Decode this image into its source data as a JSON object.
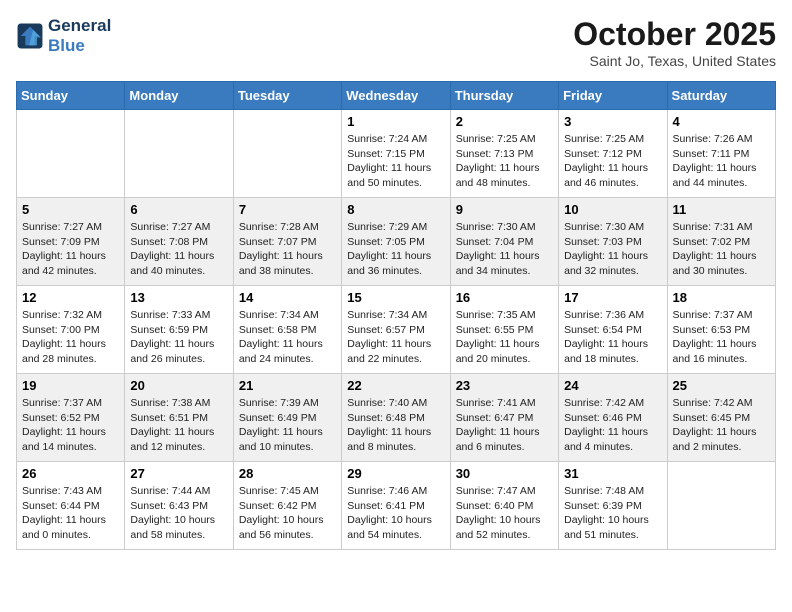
{
  "header": {
    "logo_line1": "General",
    "logo_line2": "Blue",
    "month": "October 2025",
    "location": "Saint Jo, Texas, United States"
  },
  "days_of_week": [
    "Sunday",
    "Monday",
    "Tuesday",
    "Wednesday",
    "Thursday",
    "Friday",
    "Saturday"
  ],
  "weeks": [
    [
      {
        "day": "",
        "info": ""
      },
      {
        "day": "",
        "info": ""
      },
      {
        "day": "",
        "info": ""
      },
      {
        "day": "1",
        "info": "Sunrise: 7:24 AM\nSunset: 7:15 PM\nDaylight: 11 hours and 50 minutes."
      },
      {
        "day": "2",
        "info": "Sunrise: 7:25 AM\nSunset: 7:13 PM\nDaylight: 11 hours and 48 minutes."
      },
      {
        "day": "3",
        "info": "Sunrise: 7:25 AM\nSunset: 7:12 PM\nDaylight: 11 hours and 46 minutes."
      },
      {
        "day": "4",
        "info": "Sunrise: 7:26 AM\nSunset: 7:11 PM\nDaylight: 11 hours and 44 minutes."
      }
    ],
    [
      {
        "day": "5",
        "info": "Sunrise: 7:27 AM\nSunset: 7:09 PM\nDaylight: 11 hours and 42 minutes."
      },
      {
        "day": "6",
        "info": "Sunrise: 7:27 AM\nSunset: 7:08 PM\nDaylight: 11 hours and 40 minutes."
      },
      {
        "day": "7",
        "info": "Sunrise: 7:28 AM\nSunset: 7:07 PM\nDaylight: 11 hours and 38 minutes."
      },
      {
        "day": "8",
        "info": "Sunrise: 7:29 AM\nSunset: 7:05 PM\nDaylight: 11 hours and 36 minutes."
      },
      {
        "day": "9",
        "info": "Sunrise: 7:30 AM\nSunset: 7:04 PM\nDaylight: 11 hours and 34 minutes."
      },
      {
        "day": "10",
        "info": "Sunrise: 7:30 AM\nSunset: 7:03 PM\nDaylight: 11 hours and 32 minutes."
      },
      {
        "day": "11",
        "info": "Sunrise: 7:31 AM\nSunset: 7:02 PM\nDaylight: 11 hours and 30 minutes."
      }
    ],
    [
      {
        "day": "12",
        "info": "Sunrise: 7:32 AM\nSunset: 7:00 PM\nDaylight: 11 hours and 28 minutes."
      },
      {
        "day": "13",
        "info": "Sunrise: 7:33 AM\nSunset: 6:59 PM\nDaylight: 11 hours and 26 minutes."
      },
      {
        "day": "14",
        "info": "Sunrise: 7:34 AM\nSunset: 6:58 PM\nDaylight: 11 hours and 24 minutes."
      },
      {
        "day": "15",
        "info": "Sunrise: 7:34 AM\nSunset: 6:57 PM\nDaylight: 11 hours and 22 minutes."
      },
      {
        "day": "16",
        "info": "Sunrise: 7:35 AM\nSunset: 6:55 PM\nDaylight: 11 hours and 20 minutes."
      },
      {
        "day": "17",
        "info": "Sunrise: 7:36 AM\nSunset: 6:54 PM\nDaylight: 11 hours and 18 minutes."
      },
      {
        "day": "18",
        "info": "Sunrise: 7:37 AM\nSunset: 6:53 PM\nDaylight: 11 hours and 16 minutes."
      }
    ],
    [
      {
        "day": "19",
        "info": "Sunrise: 7:37 AM\nSunset: 6:52 PM\nDaylight: 11 hours and 14 minutes."
      },
      {
        "day": "20",
        "info": "Sunrise: 7:38 AM\nSunset: 6:51 PM\nDaylight: 11 hours and 12 minutes."
      },
      {
        "day": "21",
        "info": "Sunrise: 7:39 AM\nSunset: 6:49 PM\nDaylight: 11 hours and 10 minutes."
      },
      {
        "day": "22",
        "info": "Sunrise: 7:40 AM\nSunset: 6:48 PM\nDaylight: 11 hours and 8 minutes."
      },
      {
        "day": "23",
        "info": "Sunrise: 7:41 AM\nSunset: 6:47 PM\nDaylight: 11 hours and 6 minutes."
      },
      {
        "day": "24",
        "info": "Sunrise: 7:42 AM\nSunset: 6:46 PM\nDaylight: 11 hours and 4 minutes."
      },
      {
        "day": "25",
        "info": "Sunrise: 7:42 AM\nSunset: 6:45 PM\nDaylight: 11 hours and 2 minutes."
      }
    ],
    [
      {
        "day": "26",
        "info": "Sunrise: 7:43 AM\nSunset: 6:44 PM\nDaylight: 11 hours and 0 minutes."
      },
      {
        "day": "27",
        "info": "Sunrise: 7:44 AM\nSunset: 6:43 PM\nDaylight: 10 hours and 58 minutes."
      },
      {
        "day": "28",
        "info": "Sunrise: 7:45 AM\nSunset: 6:42 PM\nDaylight: 10 hours and 56 minutes."
      },
      {
        "day": "29",
        "info": "Sunrise: 7:46 AM\nSunset: 6:41 PM\nDaylight: 10 hours and 54 minutes."
      },
      {
        "day": "30",
        "info": "Sunrise: 7:47 AM\nSunset: 6:40 PM\nDaylight: 10 hours and 52 minutes."
      },
      {
        "day": "31",
        "info": "Sunrise: 7:48 AM\nSunset: 6:39 PM\nDaylight: 10 hours and 51 minutes."
      },
      {
        "day": "",
        "info": ""
      }
    ]
  ]
}
